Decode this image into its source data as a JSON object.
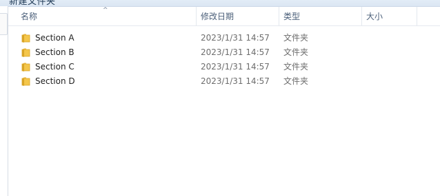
{
  "window": {
    "title_fragment": "新建文件夹"
  },
  "columns": {
    "name": "名称",
    "modified": "修改日期",
    "type": "类型",
    "size": "大小",
    "sort_indicator": "^"
  },
  "files": [
    {
      "name": "Section A",
      "modified": "2023/1/31 14:57",
      "type": "文件夹",
      "icon": "folder-icon"
    },
    {
      "name": "Section B",
      "modified": "2023/1/31 14:57",
      "type": "文件夹",
      "icon": "folder-icon"
    },
    {
      "name": "Section C",
      "modified": "2023/1/31 14:57",
      "type": "文件夹",
      "icon": "folder-icon"
    },
    {
      "name": "Section D",
      "modified": "2023/1/31 14:57",
      "type": "文件夹",
      "icon": "folder-icon"
    }
  ],
  "colors": {
    "header_text": "#4c607a",
    "folder_yellow": "#f4c64b",
    "folder_dark": "#d9a426"
  }
}
